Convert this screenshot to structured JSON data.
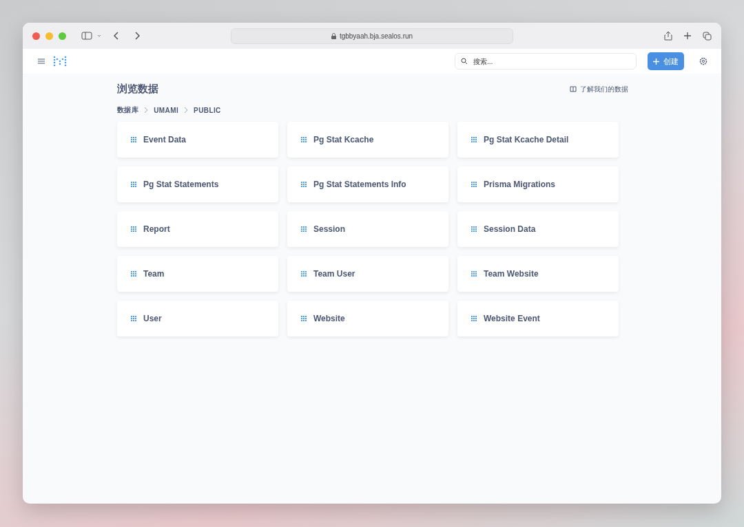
{
  "browser": {
    "url": "tgbbyaah.bja.sealos.run"
  },
  "header": {
    "search": {
      "placeholder": "搜索..."
    },
    "create_button": {
      "label": "创建"
    }
  },
  "page": {
    "title": "浏览数据",
    "learn_link": "了解我们的数据",
    "breadcrumb": [
      "数据库",
      "UMAMI",
      "PUBLIC"
    ],
    "tables": [
      "Event Data",
      "Pg Stat Kcache",
      "Pg Stat Kcache Detail",
      "Pg Stat Statements",
      "Pg Stat Statements Info",
      "Prisma Migrations",
      "Report",
      "Session",
      "Session Data",
      "Team",
      "Team User",
      "Team Website",
      "User",
      "Website",
      "Website Event"
    ]
  }
}
